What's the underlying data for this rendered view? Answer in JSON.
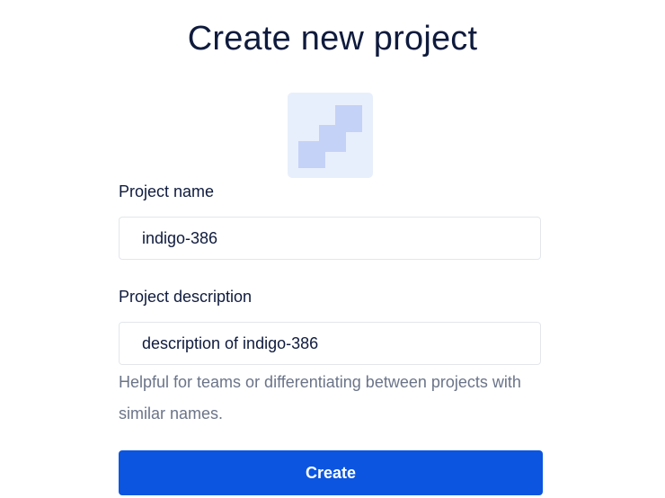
{
  "page": {
    "title": "Create new project"
  },
  "project_icon": {
    "icon": "stairs-blocks-icon",
    "background_color": "#e8effc",
    "block_color": "#c4d2f7"
  },
  "form": {
    "name": {
      "label": "Project name",
      "value": "indigo-386"
    },
    "description": {
      "label": "Project description",
      "value": "description of indigo-386",
      "helper": "Helpful for teams or differentiating between projects with similar names."
    },
    "submit": {
      "label": "Create",
      "color": "#0b55e0"
    }
  }
}
